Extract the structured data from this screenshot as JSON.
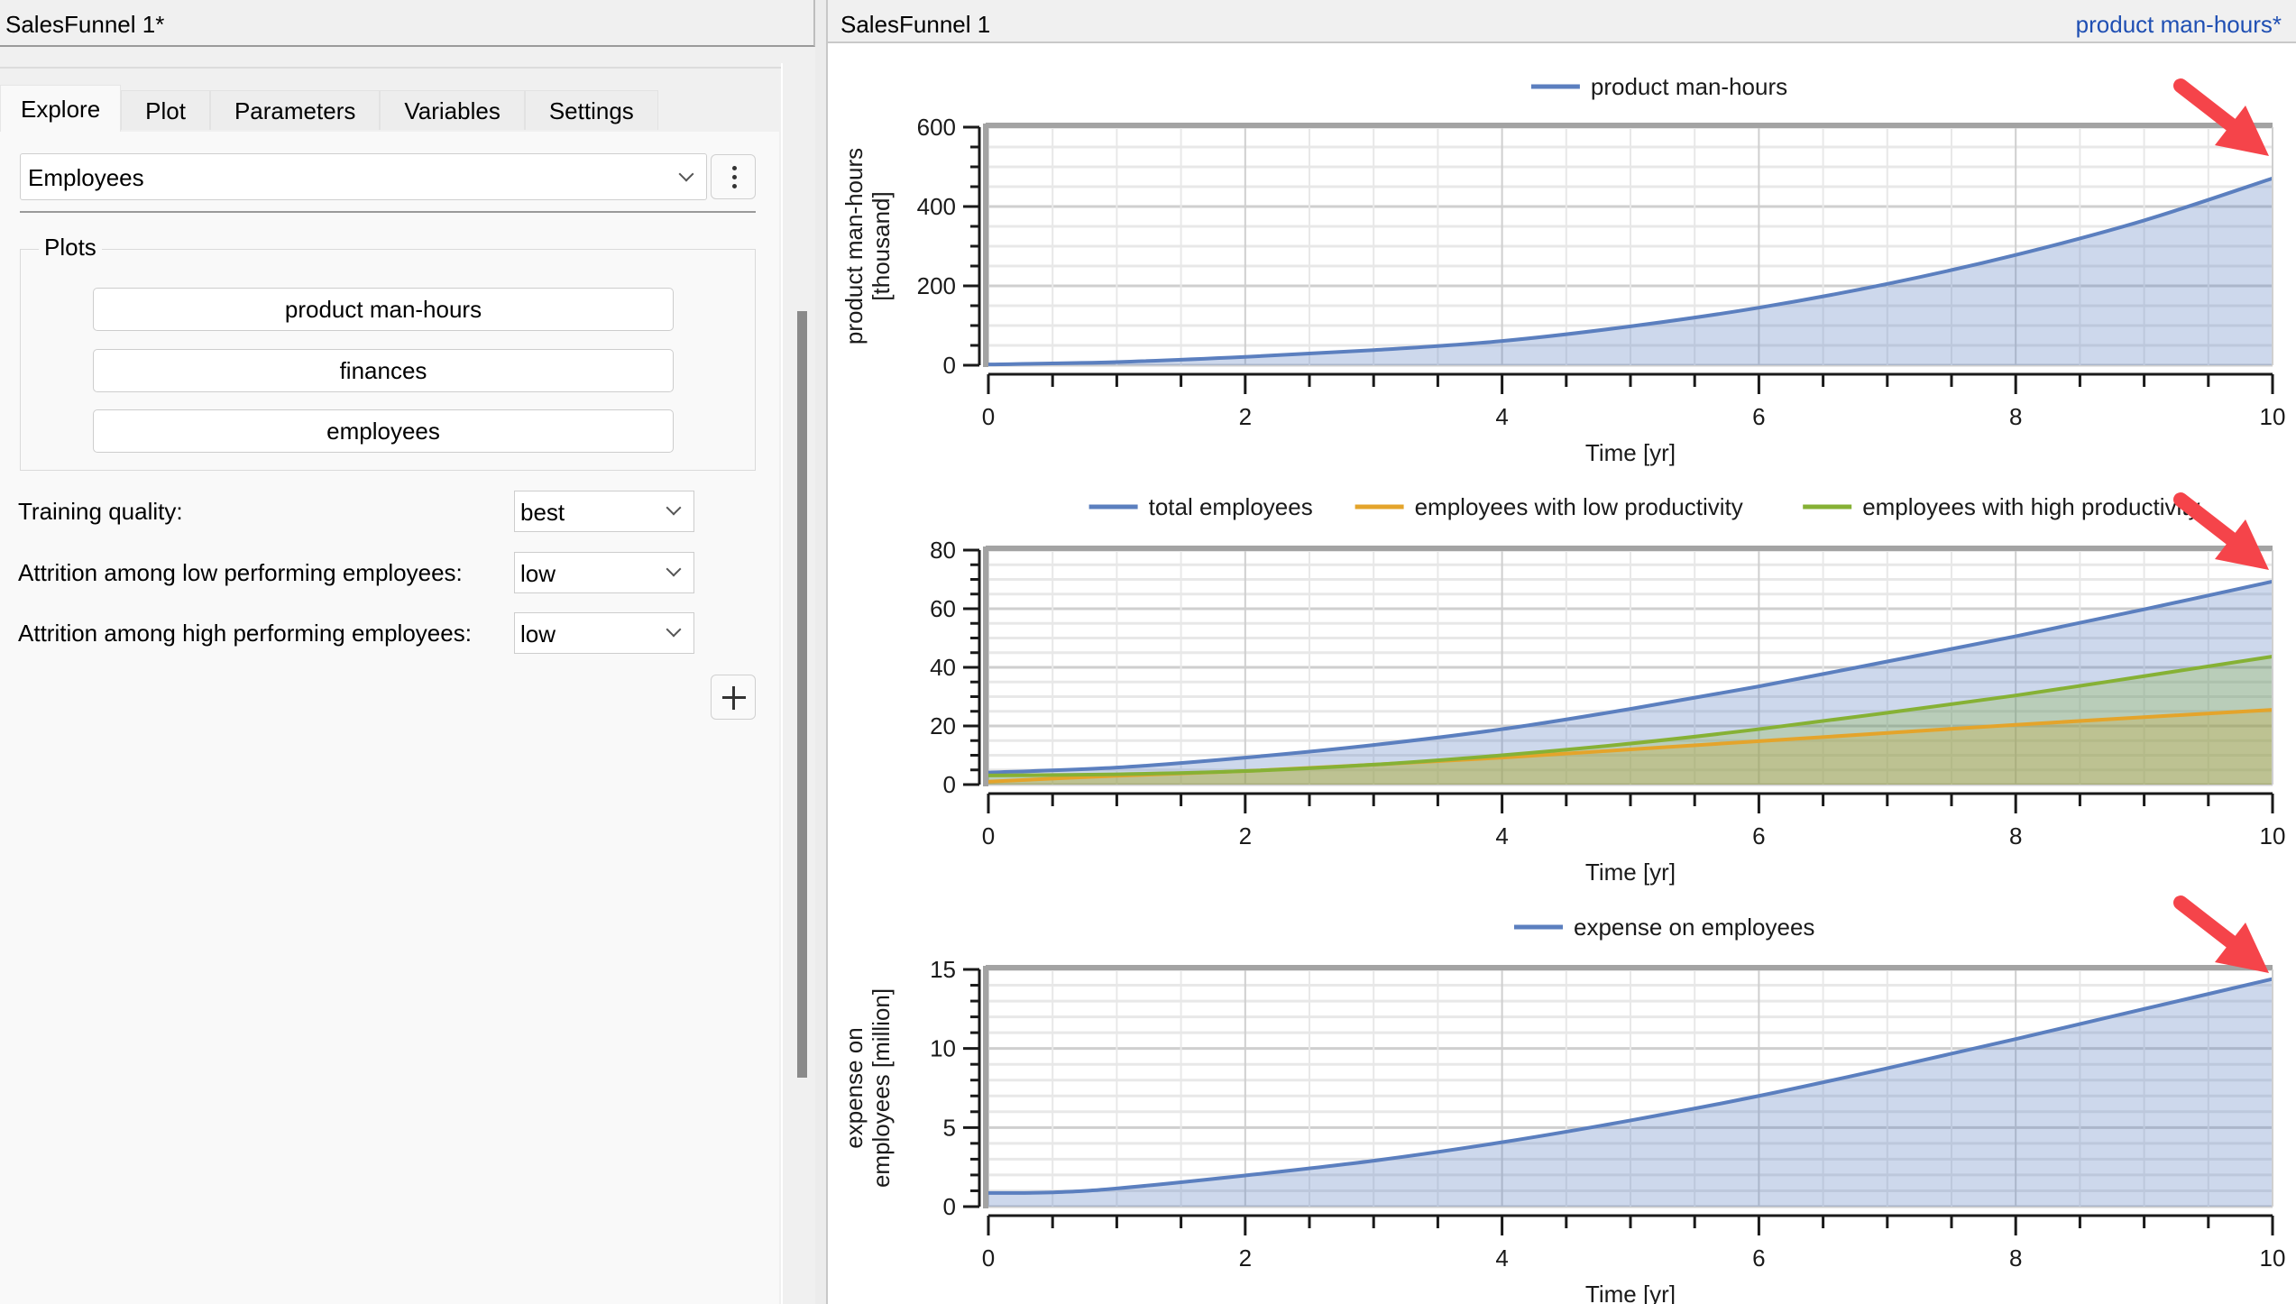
{
  "left_panel": {
    "title": "SalesFunnel 1*",
    "tabs": [
      {
        "label": "Explore",
        "active": true
      },
      {
        "label": "Plot",
        "active": false
      },
      {
        "label": "Parameters",
        "active": false
      },
      {
        "label": "Variables",
        "active": false
      },
      {
        "label": "Settings",
        "active": false
      }
    ],
    "view_select": {
      "value": "Employees",
      "menu_icon": "vertical-ellipsis-icon"
    },
    "plots_group": {
      "label": "Plots",
      "buttons": [
        "product man-hours",
        "finances",
        "employees"
      ]
    },
    "parameters": [
      {
        "label": "Training quality:",
        "value": "best"
      },
      {
        "label": "Attrition among low performing employees:",
        "value": "low"
      },
      {
        "label": "Attrition among high performing employees:",
        "value": "low"
      }
    ],
    "add_button_icon": "plus-icon"
  },
  "right_panel": {
    "title": "SalesFunnel 1",
    "active_plot": "product man-hours*"
  },
  "colors": {
    "blue": "#5b7fbf",
    "orange": "#e4a42b",
    "green": "#86b135",
    "blue_fill": "#ccd7e6",
    "arrow": "#f5444a",
    "link": "#1f4fb3"
  },
  "chart_data": [
    {
      "type": "area",
      "title": "",
      "legend": [
        "product man-hours"
      ],
      "legend_position": "top-center",
      "xlabel": "Time [yr]",
      "ylabel_lines": [
        "product man-hours",
        "[thousand]"
      ],
      "xlim": [
        0,
        10
      ],
      "ylim": [
        0,
        600
      ],
      "xticks": [
        0,
        2,
        4,
        6,
        8,
        10
      ],
      "yticks": [
        0,
        200,
        400,
        600
      ],
      "y_minor_step": 50,
      "x_minor_step": 0.5,
      "grid": true,
      "x": [
        0,
        1,
        2,
        3,
        4,
        5,
        6,
        7,
        8,
        9,
        10
      ],
      "series": [
        {
          "name": "product man-hours",
          "color": "blue",
          "values": [
            2,
            8,
            21,
            38,
            61,
            98,
            145,
            205,
            278,
            365,
            471
          ]
        }
      ],
      "annotation": "red arrow pointing at end of curve"
    },
    {
      "type": "area",
      "title": "",
      "legend": [
        "total employees",
        "employees with low productivity",
        "employees with high productivity"
      ],
      "legend_position": "top-center",
      "xlabel": "Time [yr]",
      "ylabel_lines": [],
      "xlim": [
        0,
        10
      ],
      "ylim": [
        0,
        80
      ],
      "xticks": [
        0,
        2,
        4,
        6,
        8,
        10
      ],
      "yticks": [
        0,
        20,
        40,
        60,
        80
      ],
      "y_minor_step": 5,
      "x_minor_step": 0.5,
      "grid": true,
      "x": [
        0,
        1,
        2,
        3,
        4,
        5,
        6,
        7,
        8,
        9,
        10
      ],
      "series": [
        {
          "name": "total employees",
          "color": "blue",
          "values": [
            4.1,
            5.8,
            9.2,
            13.5,
            18.9,
            25.8,
            33.5,
            42.0,
            50.6,
            59.8,
            69.3
          ]
        },
        {
          "name": "employees with low productivity",
          "color": "orange",
          "values": [
            1.0,
            3.0,
            4.6,
            6.8,
            9.2,
            12.0,
            14.8,
            17.6,
            20.4,
            23.0,
            25.5
          ]
        },
        {
          "name": "employees with high productivity",
          "color": "green",
          "values": [
            3.1,
            3.5,
            4.6,
            6.8,
            10.0,
            14.0,
            18.9,
            24.5,
            30.4,
            37.0,
            43.7
          ]
        }
      ],
      "annotation": "red arrow pointing at end of curve"
    },
    {
      "type": "area",
      "title": "",
      "legend": [
        "expense on employees"
      ],
      "legend_position": "top-center",
      "xlabel": "Time [yr]",
      "ylabel_lines": [
        "expense on",
        "employees [million]"
      ],
      "xlim": [
        0,
        10
      ],
      "ylim": [
        0,
        15
      ],
      "xticks": [
        0,
        2,
        4,
        6,
        8,
        10
      ],
      "yticks": [
        0,
        5,
        10,
        15
      ],
      "y_minor_step": 1,
      "x_minor_step": 0.5,
      "grid": true,
      "x": [
        0,
        0.5,
        1,
        2,
        3,
        4,
        5,
        6,
        7,
        8,
        9,
        10
      ],
      "series": [
        {
          "name": "expense on employees",
          "color": "blue",
          "values": [
            0.86,
            0.9,
            1.15,
            1.97,
            2.9,
            4.07,
            5.45,
            7.0,
            8.75,
            10.6,
            12.5,
            14.4
          ]
        }
      ],
      "annotation": "red arrow pointing at end of curve"
    }
  ]
}
